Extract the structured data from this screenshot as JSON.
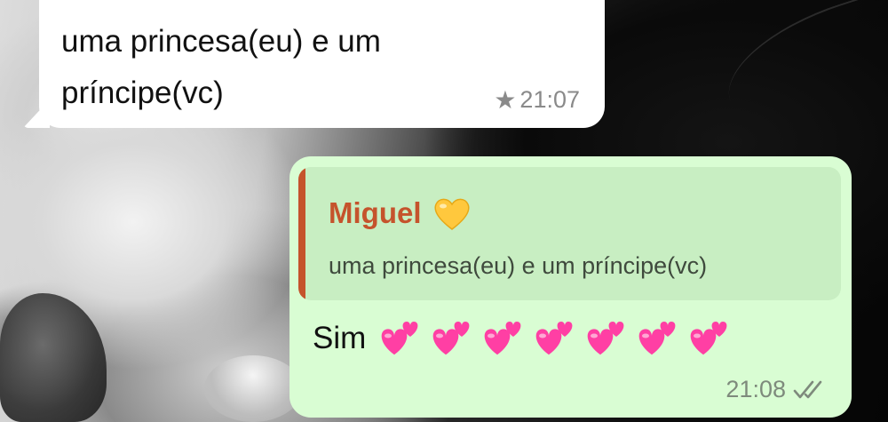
{
  "incoming_message": {
    "text": "uma princesa(eu) e um príncipe(vc)",
    "starred": true,
    "star_icon": "star-icon",
    "time": "21:07"
  },
  "outgoing_message": {
    "reply": {
      "author": "Miguel",
      "author_emoji": "yellow-heart-icon",
      "quoted_text": "uma princesa(eu) e um príncipe(vc)"
    },
    "text": "Sim",
    "emoji_icon": "two-hearts-icon",
    "emoji_count": 7,
    "time": "21:08",
    "status_icon": "double-check-icon"
  },
  "colors": {
    "incoming_bubble": "#ffffff",
    "outgoing_bubble": "#d9fdd3",
    "reply_background": "#c8eec2",
    "reply_accent": "#c5532c",
    "heart_pink": "#ff3fa4",
    "heart_yellow": "#ffc83d"
  }
}
